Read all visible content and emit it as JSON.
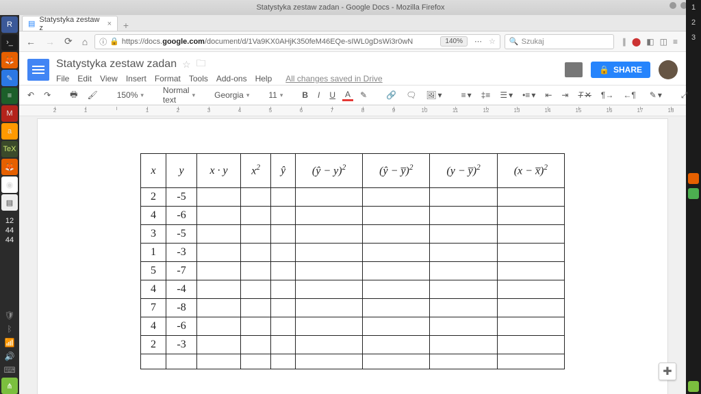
{
  "window_title": "Statystyka zestaw zadan - Google Docs - Mozilla Firefox",
  "right_nums": [
    "1",
    "2",
    "3"
  ],
  "left_time": [
    "12",
    "44",
    "44"
  ],
  "tab": {
    "title": "Statystyka zestaw z",
    "close": "×"
  },
  "url": "https://docs.google.com/document/d/1Va9KX0AHjK350feM46EQe-sIWL0gDsWi3r0wN",
  "url_prefix": "https://docs.",
  "url_domain": "google.com",
  "url_path": "/document/d/1Va9KX0AHjK350feM46EQe-sIWL0gDsWi3r0wN",
  "zoom_badge": "140%",
  "search_placeholder": "Szukaj",
  "doc": {
    "title": "Statystyka zestaw zadan",
    "menus": [
      "File",
      "Edit",
      "View",
      "Insert",
      "Format",
      "Tools",
      "Add-ons",
      "Help"
    ],
    "saved": "All changes saved in Drive",
    "share": "SHARE"
  },
  "toolbar": {
    "zoom": "150%",
    "style": "Normal text",
    "font": "Georgia",
    "size": "11"
  },
  "ruler": {
    "labels": [
      "2",
      "1",
      "",
      "1",
      "2",
      "3",
      "4",
      "5",
      "6",
      "7",
      "8",
      "9",
      "10",
      "11",
      "12",
      "13",
      "14",
      "15",
      "16",
      "17",
      "18"
    ]
  },
  "table": {
    "headers_html": [
      "<i>x</i>",
      "<i>y</i>",
      "<i>x · y</i>",
      "<i>x</i><sup>2</sup>",
      "<i>ŷ</i>",
      "(<i>ŷ</i> − <i>y</i>)<sup>2</sup>",
      "(<i>ŷ</i> − <i>y̅</i>)<sup>2</sup>",
      "(<i>y</i> − <i>y̅</i>)<sup>2</sup>",
      "(<i>x</i> − <i>x̅</i>)<sup>2</sup>"
    ],
    "rows": [
      [
        "2",
        "-5",
        "",
        "",
        "",
        "",
        "",
        "",
        ""
      ],
      [
        "4",
        "-6",
        "",
        "",
        "",
        "",
        "",
        "",
        ""
      ],
      [
        "3",
        "-5",
        "",
        "",
        "",
        "",
        "",
        "",
        ""
      ],
      [
        "1",
        "-3",
        "",
        "",
        "",
        "",
        "",
        "",
        ""
      ],
      [
        "5",
        "-7",
        "",
        "",
        "",
        "",
        "",
        "",
        ""
      ],
      [
        "4",
        "-4",
        "",
        "",
        "",
        "",
        "",
        "",
        ""
      ],
      [
        "7",
        "-8",
        "",
        "",
        "",
        "",
        "",
        "",
        ""
      ],
      [
        "4",
        "-6",
        "",
        "",
        "",
        "",
        "",
        "",
        ""
      ],
      [
        "2",
        "-3",
        "",
        "",
        "",
        "",
        "",
        "",
        ""
      ],
      [
        "",
        "",
        "",
        "",
        "",
        "",
        "",
        "",
        ""
      ]
    ]
  }
}
